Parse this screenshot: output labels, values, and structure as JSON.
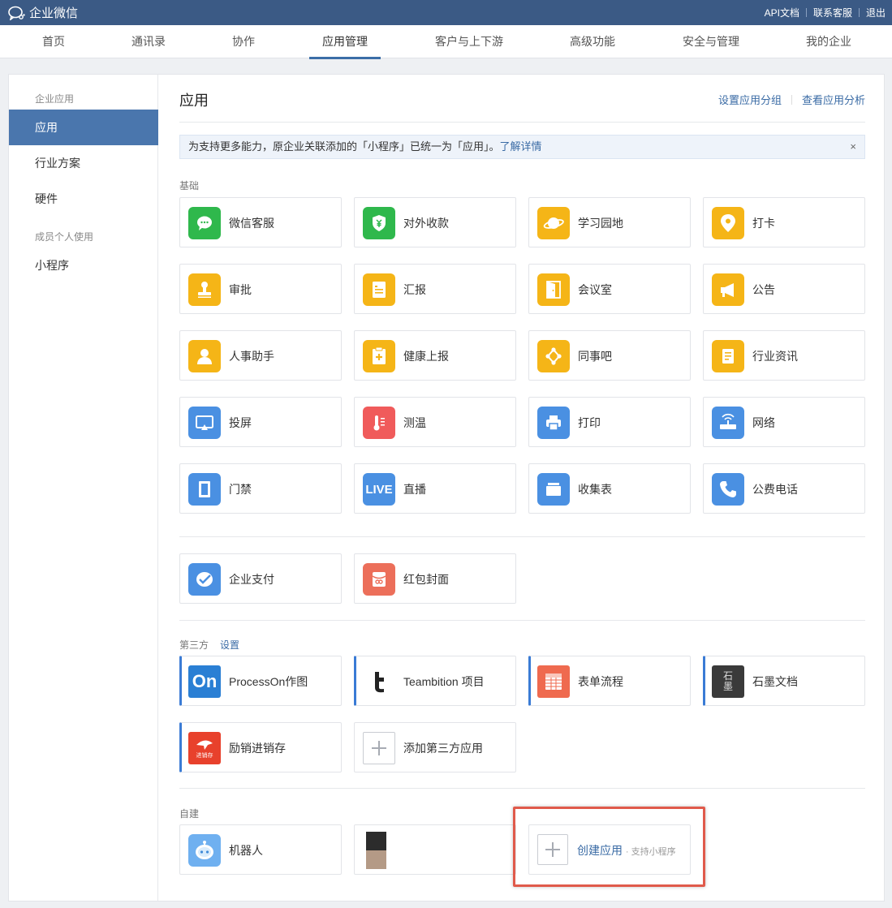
{
  "topbar": {
    "logo": "企业微信",
    "links": [
      "API文档",
      "联系客服",
      "退出"
    ]
  },
  "nav": [
    "首页",
    "通讯录",
    "协作",
    "应用管理",
    "客户与上下游",
    "高级功能",
    "安全与管理",
    "我的企业"
  ],
  "nav_active": "应用管理",
  "sidebar": {
    "group1": "企业应用",
    "items1": [
      "应用",
      "行业方案",
      "硬件"
    ],
    "group2": "成员个人使用",
    "items2": [
      "小程序"
    ]
  },
  "main": {
    "title": "应用",
    "header_links": [
      "设置应用分组",
      "查看应用分析"
    ],
    "notice_text": "为支持更多能力，原企业关联添加的「小程序」已统一为「应用」。",
    "notice_link": "了解详情",
    "notice_close": "×",
    "basic_label": "基础",
    "basic_apps": [
      "微信客服",
      "对外收款",
      "学习园地",
      "打卡",
      "审批",
      "汇报",
      "会议室",
      "公告",
      "人事助手",
      "健康上报",
      "同事吧",
      "行业资讯",
      "投屏",
      "测温",
      "打印",
      "网络",
      "门禁",
      "直播",
      "收集表",
      "公费电话"
    ],
    "pay_apps": [
      "企业支付",
      "红包封面"
    ],
    "third_label": "第三方",
    "third_settings": "设置",
    "third_apps": [
      "ProcessOn作图",
      "Teambition 项目",
      "表单流程",
      "石墨文档",
      "励销进销存"
    ],
    "third_add": "添加第三方应用",
    "self_label": "自建",
    "self_apps": [
      "机器人",
      ""
    ],
    "create_label": "创建应用",
    "create_sub": "· 支持小程序"
  },
  "icon_text": {
    "live": "LIVE",
    "on": "On",
    "shimo": "石墨",
    "lixiao": "进销存"
  },
  "colors": {
    "topbar": "#3b5a85",
    "accent": "#3a6ba5",
    "green": "#2fb84c",
    "yellow": "#f5b517",
    "blue": "#4a90e2",
    "red": "#f05b5b",
    "highlight": "#e05a4b"
  }
}
